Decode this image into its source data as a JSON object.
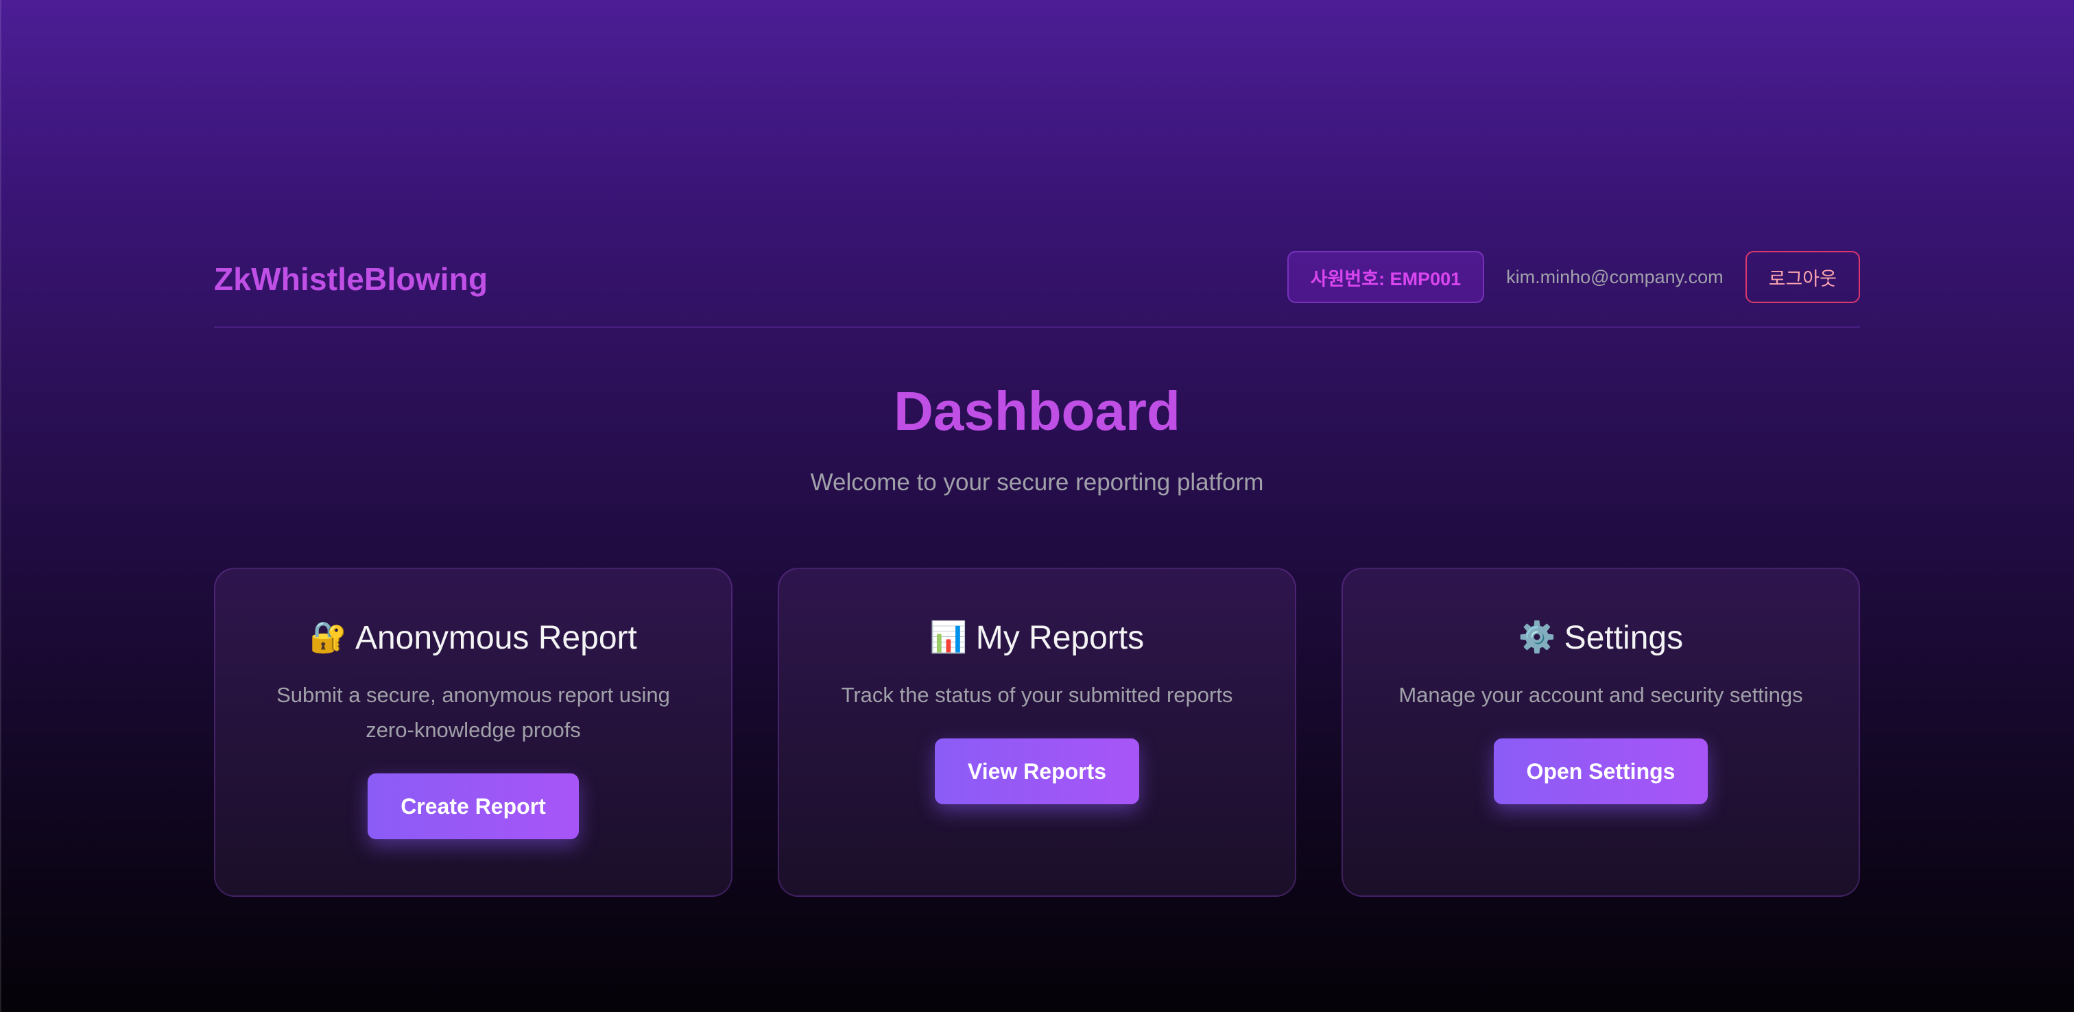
{
  "header": {
    "brand": "ZkWhistleBlowing",
    "employee_badge": "사원번호: EMP001",
    "email": "kim.minho@company.com",
    "logout_label": "로그아웃"
  },
  "hero": {
    "title": "Dashboard",
    "subtitle": "Welcome to your secure reporting platform"
  },
  "cards": [
    {
      "icon": "🔐",
      "icon_name": "lock-with-key-icon",
      "title": "Anonymous Report",
      "description": "Submit a secure, anonymous report using zero-knowledge proofs",
      "button_label": "Create Report"
    },
    {
      "icon": "📊",
      "icon_name": "bar-chart-icon",
      "title": "My Reports",
      "description": "Track the status of your submitted reports",
      "button_label": "View Reports"
    },
    {
      "icon": "⚙️",
      "icon_name": "gear-icon",
      "title": "Settings",
      "description": "Manage your account and security settings",
      "button_label": "Open Settings"
    }
  ],
  "colors": {
    "brand": "#c04fe6",
    "button_gradient_start": "#8b5cf6",
    "button_gradient_end": "#a855f7",
    "logout_border": "#d9386d"
  }
}
